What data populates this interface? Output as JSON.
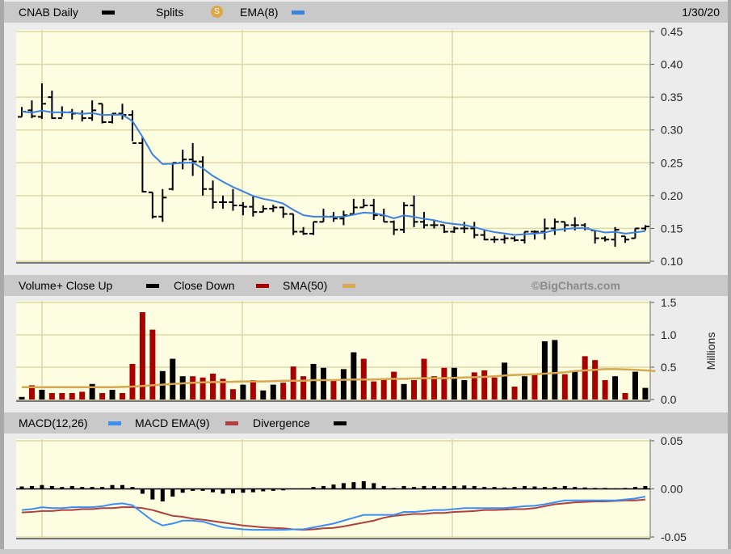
{
  "header_price": {
    "symbol_label": "CNAB Daily",
    "splits_label": "Splits",
    "splits_icon": "S",
    "ema_label": "EMA(8)",
    "date": "1/30/20"
  },
  "header_volume": {
    "up_label": "Volume+ Close Up",
    "down_label": "Close Down",
    "sma_label": "SMA(50)",
    "brand": "©BigCharts.com"
  },
  "header_macd": {
    "macd_label": "MACD(12,26)",
    "signal_label": "MACD EMA(9)",
    "divergence_label": "Divergence"
  },
  "colors": {
    "price": "#000000",
    "ema": "#3b82e0",
    "volume_up": "#000000",
    "volume_down": "#a80000",
    "sma": "#d6a850",
    "macd": "#3b8ff0",
    "signal": "#b04040",
    "divergence": "#000000",
    "plot_bg": "#fdfde2",
    "grid": "#dcd8a8"
  },
  "chart_data": [
    {
      "type": "ohlc",
      "ylim": [
        0.1,
        0.45
      ],
      "yticks": [
        "0.45",
        "0.40",
        "0.35",
        "0.30",
        "0.25",
        "0.20",
        "0.15",
        "0.10"
      ],
      "ema_period": 8,
      "open": [
        0.32,
        0.33,
        0.32,
        0.35,
        0.318,
        0.327,
        0.325,
        0.318,
        0.34,
        0.312,
        0.325,
        0.323,
        0.28,
        0.205,
        0.168,
        0.21,
        0.25,
        0.255,
        0.252,
        0.21,
        0.19,
        0.19,
        0.185,
        0.183,
        0.175,
        0.18,
        0.182,
        0.172,
        0.145,
        0.142,
        0.16,
        0.168,
        0.165,
        0.172,
        0.182,
        0.185,
        0.17,
        0.16,
        0.148,
        0.185,
        0.16,
        0.155,
        0.155,
        0.145,
        0.15,
        0.15,
        0.14,
        0.133,
        0.133,
        0.135,
        0.132,
        0.145,
        0.145,
        0.15,
        0.16,
        0.155,
        0.155,
        0.147,
        0.135,
        0.133,
        0.138,
        0.135,
        0.15
      ],
      "high": [
        0.335,
        0.345,
        0.371,
        0.36,
        0.336,
        0.332,
        0.33,
        0.345,
        0.34,
        0.325,
        0.34,
        0.33,
        0.29,
        0.205,
        0.21,
        0.25,
        0.27,
        0.28,
        0.26,
        0.223,
        0.2,
        0.21,
        0.19,
        0.2,
        0.185,
        0.186,
        0.183,
        0.172,
        0.152,
        0.16,
        0.18,
        0.175,
        0.177,
        0.195,
        0.195,
        0.195,
        0.18,
        0.162,
        0.19,
        0.2,
        0.175,
        0.162,
        0.155,
        0.153,
        0.16,
        0.16,
        0.147,
        0.138,
        0.14,
        0.138,
        0.145,
        0.147,
        0.165,
        0.165,
        0.16,
        0.167,
        0.158,
        0.147,
        0.138,
        0.152,
        0.138,
        0.15,
        0.155
      ],
      "low": [
        0.32,
        0.318,
        0.317,
        0.317,
        0.32,
        0.316,
        0.313,
        0.314,
        0.31,
        0.31,
        0.316,
        0.283,
        0.205,
        0.165,
        0.16,
        0.208,
        0.24,
        0.23,
        0.2,
        0.18,
        0.18,
        0.177,
        0.17,
        0.168,
        0.175,
        0.175,
        0.166,
        0.14,
        0.14,
        0.14,
        0.16,
        0.16,
        0.155,
        0.172,
        0.182,
        0.163,
        0.16,
        0.14,
        0.143,
        0.152,
        0.15,
        0.15,
        0.143,
        0.143,
        0.143,
        0.135,
        0.132,
        0.128,
        0.127,
        0.13,
        0.127,
        0.133,
        0.133,
        0.14,
        0.145,
        0.147,
        0.147,
        0.127,
        0.13,
        0.122,
        0.128,
        0.135,
        0.147
      ],
      "close": [
        0.328,
        0.321,
        0.34,
        0.318,
        0.327,
        0.325,
        0.318,
        0.33,
        0.312,
        0.325,
        0.323,
        0.28,
        0.206,
        0.168,
        0.197,
        0.25,
        0.255,
        0.252,
        0.21,
        0.19,
        0.19,
        0.185,
        0.183,
        0.175,
        0.18,
        0.182,
        0.172,
        0.145,
        0.142,
        0.16,
        0.168,
        0.165,
        0.17,
        0.182,
        0.185,
        0.17,
        0.16,
        0.148,
        0.185,
        0.16,
        0.155,
        0.155,
        0.145,
        0.15,
        0.15,
        0.14,
        0.133,
        0.133,
        0.135,
        0.132,
        0.145,
        0.145,
        0.15,
        0.16,
        0.155,
        0.155,
        0.15,
        0.135,
        0.133,
        0.148,
        0.133,
        0.15,
        0.153
      ]
    },
    {
      "type": "bar",
      "ylabel": "Millions",
      "ylim": [
        0,
        1.5
      ],
      "yticks": [
        "1.5",
        "1.0",
        "0.5",
        "0.0"
      ],
      "values": [
        0.04,
        0.22,
        0.15,
        0.1,
        0.1,
        0.1,
        0.12,
        0.24,
        0.1,
        0.15,
        0.1,
        0.55,
        1.35,
        1.08,
        0.44,
        0.63,
        0.36,
        0.36,
        0.34,
        0.4,
        0.32,
        0.16,
        0.23,
        0.3,
        0.14,
        0.23,
        0.26,
        0.51,
        0.36,
        0.55,
        0.49,
        0.3,
        0.47,
        0.73,
        0.63,
        0.28,
        0.33,
        0.43,
        0.24,
        0.3,
        0.63,
        0.36,
        0.49,
        0.49,
        0.3,
        0.42,
        0.45,
        0.34,
        0.57,
        0.2,
        0.36,
        0.39,
        0.9,
        0.92,
        0.39,
        0.45,
        0.67,
        0.61,
        0.3,
        0.36,
        0.1,
        0.43,
        0.18
      ],
      "close_up": [
        1,
        0,
        1,
        0,
        0,
        0,
        0,
        1,
        0,
        1,
        0,
        0,
        0,
        0,
        1,
        1,
        1,
        0,
        0,
        0,
        0,
        0,
        1,
        0,
        1,
        1,
        0,
        0,
        0,
        1,
        1,
        0,
        1,
        1,
        0,
        0,
        0,
        0,
        1,
        0,
        0,
        0,
        0,
        1,
        1,
        0,
        0,
        0,
        1,
        0,
        1,
        0,
        1,
        1,
        0,
        1,
        0,
        0,
        0,
        1,
        0,
        1,
        1
      ],
      "sma50": [
        0.19,
        0.19,
        0.19,
        0.19,
        0.19,
        0.19,
        0.19,
        0.19,
        0.19,
        0.19,
        0.195,
        0.2,
        0.21,
        0.22,
        0.23,
        0.24,
        0.25,
        0.26,
        0.265,
        0.27,
        0.27,
        0.275,
        0.28,
        0.28,
        0.28,
        0.285,
        0.29,
        0.29,
        0.29,
        0.3,
        0.3,
        0.3,
        0.305,
        0.31,
        0.31,
        0.31,
        0.315,
        0.32,
        0.32,
        0.325,
        0.33,
        0.33,
        0.33,
        0.335,
        0.34,
        0.345,
        0.35,
        0.36,
        0.37,
        0.38,
        0.385,
        0.39,
        0.4,
        0.41,
        0.42,
        0.44,
        0.45,
        0.46,
        0.47,
        0.47,
        0.465,
        0.46,
        0.45,
        0.44
      ]
    },
    {
      "type": "line",
      "ylim": [
        -0.05,
        0.05
      ],
      "yticks": [
        "0.05",
        "0.00",
        "-0.05"
      ],
      "macd": [
        -0.022,
        -0.021,
        -0.019,
        -0.02,
        -0.02,
        -0.019,
        -0.019,
        -0.019,
        -0.018,
        -0.016,
        -0.015,
        -0.017,
        -0.025,
        -0.033,
        -0.038,
        -0.036,
        -0.033,
        -0.033,
        -0.034,
        -0.037,
        -0.04,
        -0.041,
        -0.042,
        -0.0425,
        -0.0425,
        -0.0425,
        -0.0425,
        -0.042,
        -0.042,
        -0.04,
        -0.038,
        -0.036,
        -0.033,
        -0.03,
        -0.027,
        -0.027,
        -0.027,
        -0.027,
        -0.024,
        -0.024,
        -0.023,
        -0.022,
        -0.022,
        -0.021,
        -0.02,
        -0.02,
        -0.02,
        -0.02,
        -0.02,
        -0.019,
        -0.018,
        -0.0175,
        -0.016,
        -0.014,
        -0.012,
        -0.012,
        -0.012,
        -0.012,
        -0.012,
        -0.012,
        -0.011,
        -0.01,
        -0.008
      ],
      "signal": [
        -0.0245,
        -0.024,
        -0.023,
        -0.023,
        -0.022,
        -0.022,
        -0.021,
        -0.021,
        -0.02,
        -0.02,
        -0.019,
        -0.019,
        -0.02,
        -0.022,
        -0.025,
        -0.028,
        -0.029,
        -0.031,
        -0.032,
        -0.0335,
        -0.035,
        -0.0365,
        -0.038,
        -0.039,
        -0.04,
        -0.0405,
        -0.041,
        -0.042,
        -0.0425,
        -0.042,
        -0.041,
        -0.0405,
        -0.039,
        -0.037,
        -0.035,
        -0.033,
        -0.03,
        -0.028,
        -0.027,
        -0.026,
        -0.026,
        -0.025,
        -0.025,
        -0.024,
        -0.0235,
        -0.023,
        -0.022,
        -0.022,
        -0.0215,
        -0.021,
        -0.021,
        -0.02,
        -0.018,
        -0.016,
        -0.015,
        -0.014,
        -0.0135,
        -0.013,
        -0.013,
        -0.0125,
        -0.012,
        -0.012,
        -0.011
      ]
    }
  ]
}
